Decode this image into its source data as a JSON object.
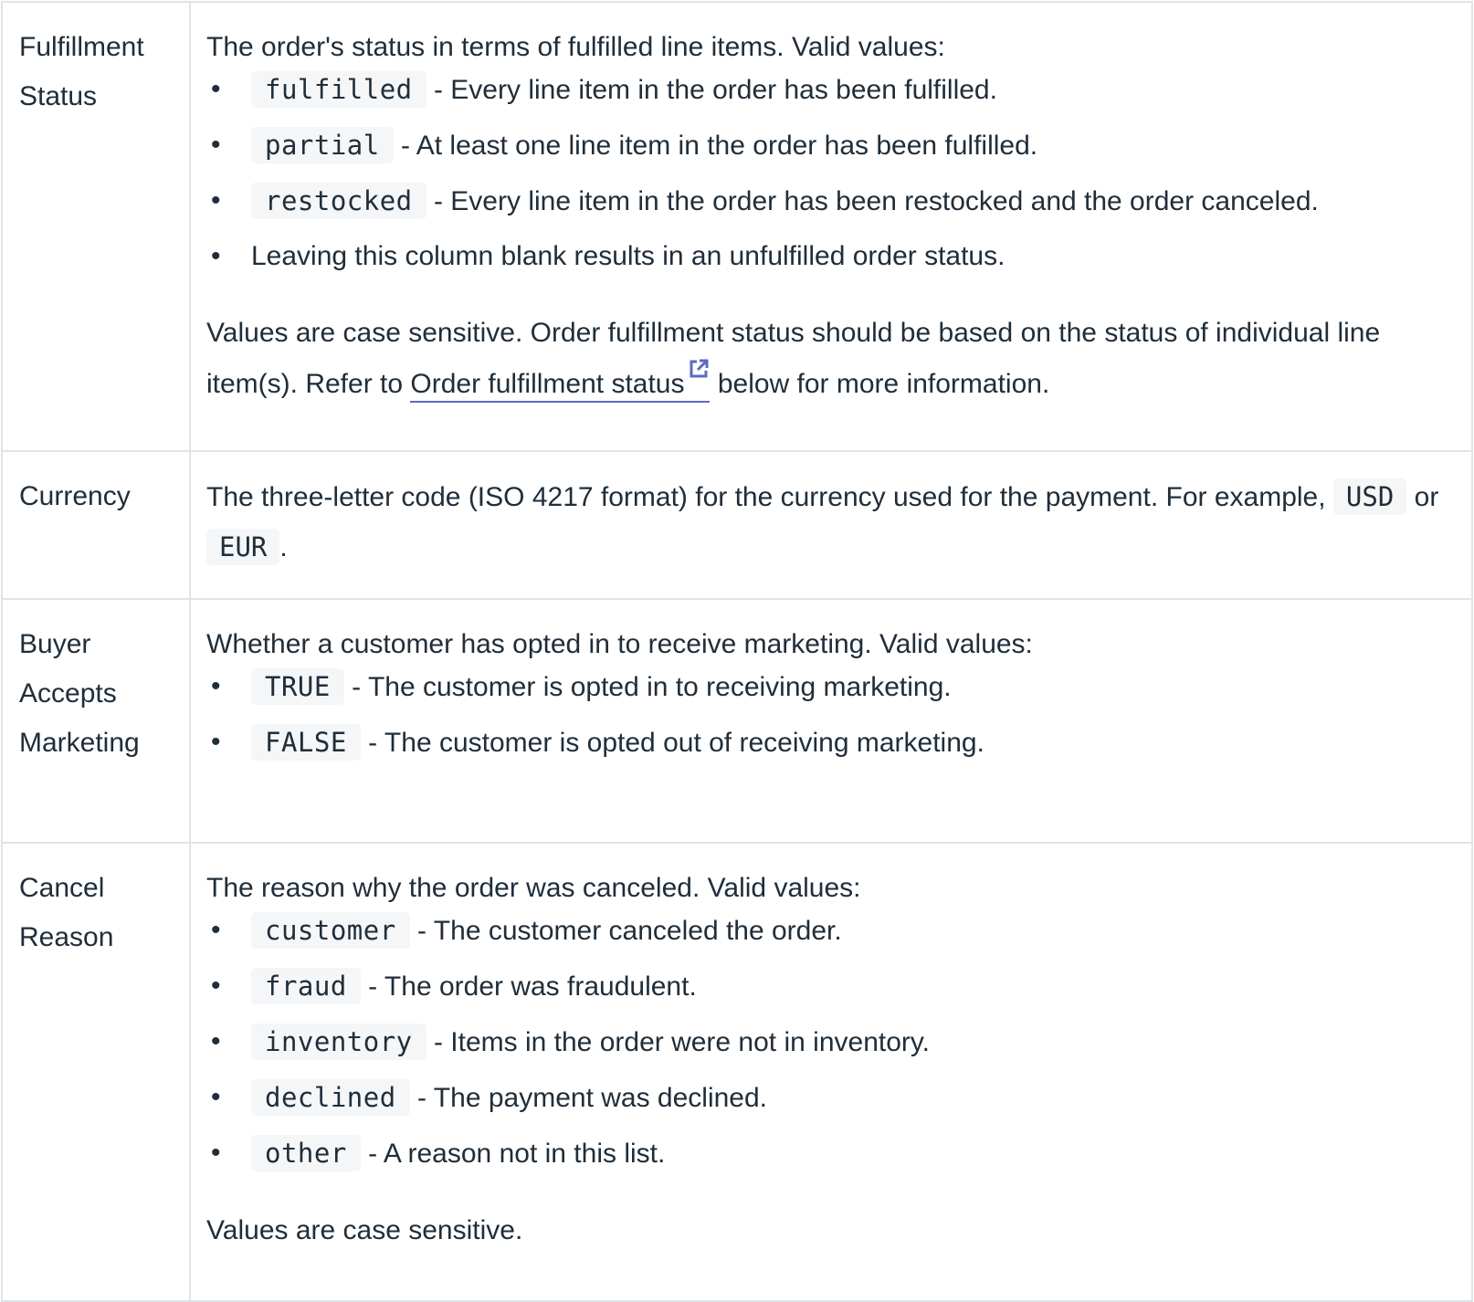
{
  "rows": [
    {
      "name": "Fulfillment Status",
      "intro": "The order's status in terms of fulfilled line items. Valid values:",
      "items": [
        {
          "code": "fulfilled",
          "text": " - Every line item in the order has been fulfilled."
        },
        {
          "code": "partial",
          "text": " - At least one line item in the order has been fulfilled."
        },
        {
          "code": "restocked",
          "text": " - Every line item in the order has been restocked and the order canceled."
        },
        {
          "code": "",
          "text": "Leaving this column blank results in an unfulfilled order status."
        }
      ],
      "note_before": "Values are case sensitive. Order fulfillment status should be based on the status of individual line item(s). Refer to ",
      "link_text": "Order fulfillment status",
      "link_icon": "external-link-icon",
      "note_after": " below for more information."
    },
    {
      "name": "Currency",
      "text_before": "The three-letter code (ISO 4217 format) for the currency used for the payment. For example, ",
      "code1": "USD",
      "mid": " or ",
      "code2": "EUR",
      "end": "."
    },
    {
      "name": "Buyer Accepts Marketing",
      "intro": "Whether a customer has opted in to receive marketing. Valid values:",
      "items": [
        {
          "code": "TRUE",
          "text": " - The customer is opted in to receiving marketing."
        },
        {
          "code": "FALSE",
          "text": " - The customer is opted out of receiving marketing."
        }
      ]
    },
    {
      "name": "Cancel Reason",
      "intro": "The reason why the order was canceled. Valid values:",
      "items": [
        {
          "code": "customer",
          "text": " - The customer canceled the order."
        },
        {
          "code": "fraud",
          "text": " - The order was fraudulent."
        },
        {
          "code": "inventory",
          "text": " - Items in the order were not in inventory."
        },
        {
          "code": "declined",
          "text": " - The payment was declined."
        },
        {
          "code": "other",
          "text": " - A reason not in this list."
        }
      ],
      "note": "Values are case sensitive."
    }
  ],
  "colors": {
    "text": "#202e3a",
    "border": "#e1e3e5",
    "code_bg": "#f4f6f8",
    "link_underline": "#5c6ac4"
  },
  "bullet": "•"
}
